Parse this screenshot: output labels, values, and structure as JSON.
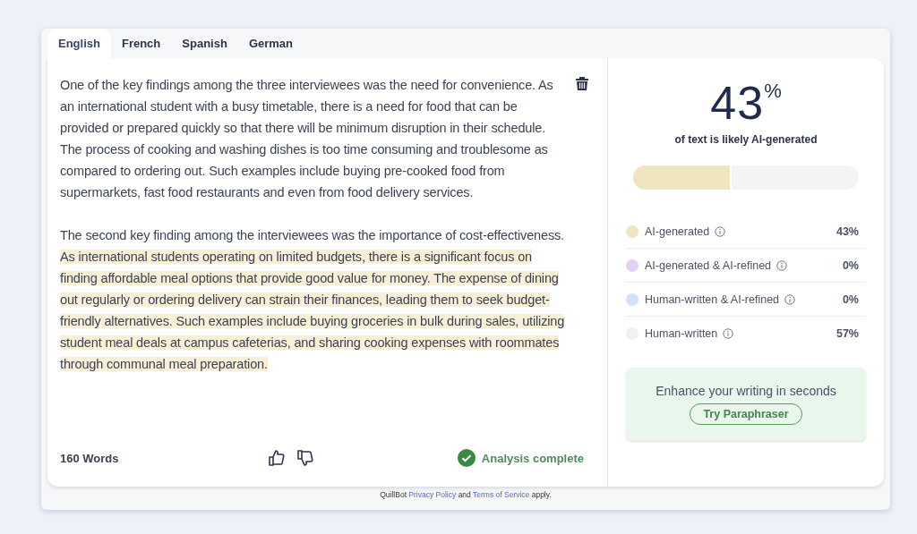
{
  "tabs": [
    {
      "label": "English",
      "selected": true
    },
    {
      "label": "French",
      "selected": false
    },
    {
      "label": "Spanish",
      "selected": false
    },
    {
      "label": "German",
      "selected": false
    }
  ],
  "editor": {
    "paragraphs": [
      {
        "segments": [
          {
            "text": "One of the key findings among the three interviewees was the need for convenience. As an international student with a busy timetable, there is a need for food that can be provided or prepared quickly so that there will be minimum disruption in their schedule. The process of cooking and washing dishes is too time consuming and troublesome as compared to ordering out. Such examples include buying pre-cooked food from supermarkets, fast food restaurants and even from food delivery services.",
            "highlighted": false
          }
        ]
      },
      {
        "segments": [
          {
            "text": "The second key finding among the interviewees was the importance of cost-effectiveness. ",
            "highlighted": false
          },
          {
            "text": "As international students operating on limited budgets, there is a significant focus on finding affordable meal options that provide good value for money. The expense of dining out regularly or ordering delivery can strain their finances, leading them to seek budget-friendly alternatives. Such examples include buying groceries in bulk during sales, utilizing student meal deals at campus cafeterias, and sharing cooking expenses with roommates through communal meal preparation.",
            "highlighted": true
          }
        ]
      }
    ],
    "word_count": "160 Words",
    "status": "Analysis complete"
  },
  "result": {
    "score": "43",
    "unit": "%",
    "caption": "of text is likely AI-generated",
    "level": 0.43,
    "legend": [
      {
        "label": "AI-generated",
        "value": "43%",
        "color": "#efe6bf"
      },
      {
        "label": "AI-generated & AI-refined",
        "value": "0%",
        "color": "#e3d0f6"
      },
      {
        "label": "Human-written & AI-refined",
        "value": "0%",
        "color": "#d6dffb"
      },
      {
        "label": "Human-written",
        "value": "57%",
        "color": "#f1f1f1"
      }
    ],
    "promo": {
      "text": "Enhance your writing in seconds",
      "button": "Try Paraphraser"
    }
  },
  "footer": [
    {
      "text": "QuillBot ",
      "link": false
    },
    {
      "text": "Privacy Policy",
      "link": true
    },
    {
      "text": " and ",
      "link": false
    },
    {
      "text": "Terms of Service",
      "link": true
    },
    {
      "text": " apply.",
      "link": false
    }
  ]
}
